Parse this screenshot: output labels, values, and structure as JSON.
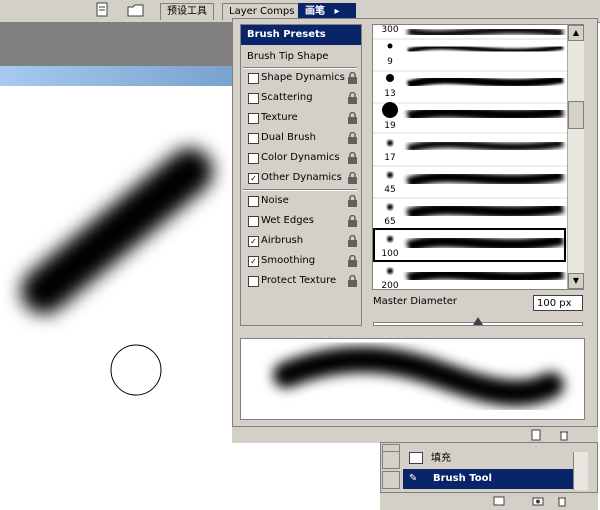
{
  "topbar": {
    "tabs": [
      {
        "label": "预设工具"
      },
      {
        "label": "Layer Comps"
      },
      {
        "label": "画笔"
      }
    ],
    "icons": [
      "document-icon",
      "folder-icon"
    ]
  },
  "brushes_panel": {
    "header": "Brush Presets",
    "tip_shape": "Brush Tip Shape",
    "options": [
      {
        "label": "Shape Dynamics",
        "checked": false
      },
      {
        "label": "Scattering",
        "checked": false
      },
      {
        "label": "Texture",
        "checked": false
      },
      {
        "label": "Dual Brush",
        "checked": false
      },
      {
        "label": "Color Dynamics",
        "checked": false
      },
      {
        "label": "Other Dynamics",
        "checked": true
      }
    ],
    "options2": [
      {
        "label": "Noise",
        "checked": false
      },
      {
        "label": "Wet Edges",
        "checked": false
      },
      {
        "label": "Airbrush",
        "checked": true
      },
      {
        "label": "Smoothing",
        "checked": true
      },
      {
        "label": "Protect Texture",
        "checked": false
      }
    ],
    "brush_sizes": [
      "300",
      "9",
      "13",
      "19",
      "17",
      "45",
      "65",
      "100",
      "200"
    ],
    "selected_brush": "100",
    "master_diameter_label": "Master Diameter",
    "master_diameter_value": "100 px",
    "master_diameter_level": 0.5
  },
  "history_panel": {
    "items": [
      {
        "label": ""
      },
      {
        "label": "填充"
      },
      {
        "label": "Brush Tool"
      }
    ],
    "selected": "Brush Tool"
  },
  "colors": {
    "chrome": "#d4d0c8",
    "selection": "#0a246a",
    "title_gradient": "#7aa2cf"
  }
}
